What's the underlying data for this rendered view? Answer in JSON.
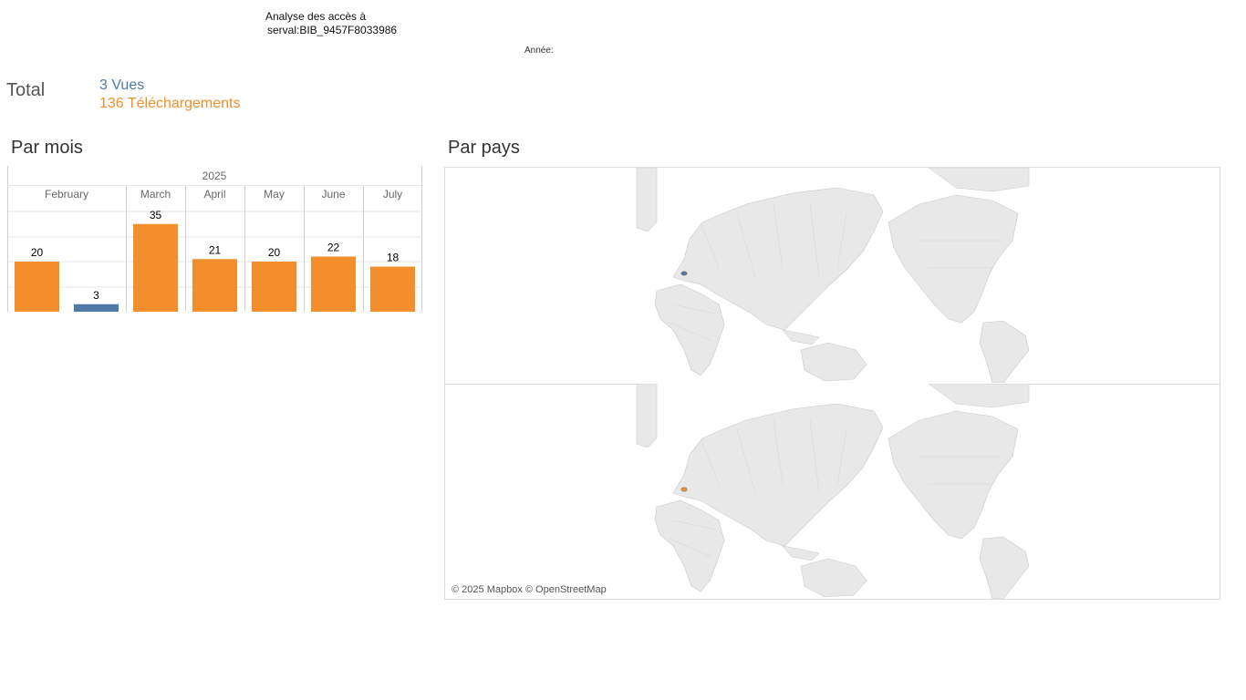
{
  "header": {
    "title_line1": "Analyse des accès à",
    "title_line2": "serval:BIB_9457F8033986",
    "year_filter_label": "Année:"
  },
  "totals": {
    "label": "Total",
    "views": "3 Vues",
    "downloads": "136 Téléchargements"
  },
  "sections": {
    "by_month": "Par mois",
    "by_country": "Par pays"
  },
  "colors": {
    "views": "#4e79a7",
    "downloads": "#f28e2b",
    "grid": "#e6e6e6",
    "axis_text": "#666666"
  },
  "chart_data": {
    "type": "bar",
    "year": "2025",
    "categories": [
      "February",
      "March",
      "April",
      "May",
      "June",
      "July"
    ],
    "series": [
      {
        "name": "Téléchargements",
        "values": [
          20,
          35,
          21,
          20,
          22,
          18
        ]
      },
      {
        "name": "Vues",
        "values": [
          3,
          null,
          null,
          null,
          null,
          null
        ]
      }
    ],
    "ylim": [
      0,
      40
    ]
  },
  "map": {
    "attribution": "© 2025 Mapbox © OpenStreetMap"
  }
}
